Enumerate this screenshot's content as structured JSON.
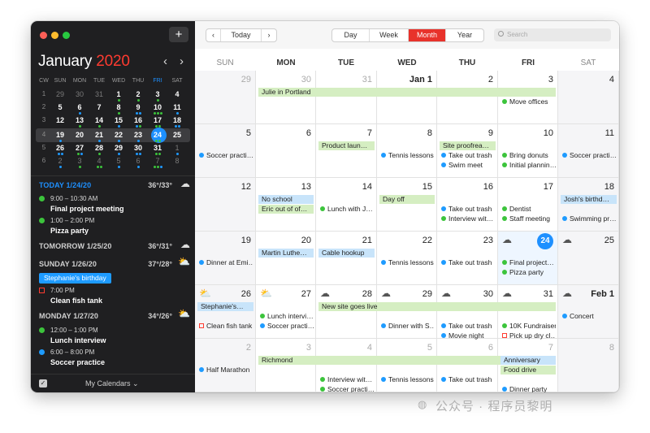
{
  "sidebar": {
    "add_label": "+",
    "month": "January",
    "year": "2020",
    "prev_arrow": "‹",
    "next_arrow": "›",
    "mini_headers": [
      "CW",
      "SUN",
      "MON",
      "TUE",
      "WED",
      "THU",
      "FRI",
      "SAT"
    ],
    "mini_weeks": [
      {
        "cw": "1",
        "days": [
          "29",
          "30",
          "31",
          "1",
          "2",
          "3",
          "4"
        ]
      },
      {
        "cw": "2",
        "days": [
          "5",
          "6",
          "7",
          "8",
          "9",
          "10",
          "11"
        ]
      },
      {
        "cw": "3",
        "days": [
          "12",
          "13",
          "14",
          "15",
          "16",
          "17",
          "18"
        ]
      },
      {
        "cw": "4",
        "days": [
          "19",
          "20",
          "21",
          "22",
          "23",
          "24",
          "25"
        ]
      },
      {
        "cw": "5",
        "days": [
          "26",
          "27",
          "28",
          "29",
          "30",
          "31",
          "1"
        ]
      },
      {
        "cw": "6",
        "days": [
          "2",
          "3",
          "4",
          "5",
          "6",
          "7",
          "8"
        ]
      }
    ],
    "agenda": {
      "today_head": "TODAY 1/24/20",
      "today_temp": "36°/33°",
      "ev1_time": "9:00 – 10:30 AM",
      "ev1_title": "Final project meeting",
      "ev2_time": "1:00 – 2:00 PM",
      "ev2_title": "Pizza party",
      "tomorrow_head": "TOMORROW 1/25/20",
      "tomorrow_temp": "36°/31°",
      "sunday_head": "SUNDAY 1/26/20",
      "sunday_temp": "37°/28°",
      "sunday_allday": "Stephanie's birthday",
      "sunday_ev_time": "7:00 PM",
      "sunday_ev_title": "Clean fish tank",
      "monday_head": "MONDAY 1/27/20",
      "monday_temp": "34°/26°",
      "mon_ev1_time": "12:00 – 1:00 PM",
      "mon_ev1_title": "Lunch interview",
      "mon_ev2_time": "6:00 – 8:00 PM",
      "mon_ev2_title": "Soccer practice"
    },
    "footer_label": "My Calendars"
  },
  "toolbar": {
    "prev": "‹",
    "today": "Today",
    "next": "›",
    "views": [
      "Day",
      "Week",
      "Month",
      "Year"
    ],
    "selected_view": "Month",
    "search_placeholder": "Search"
  },
  "weekdays": [
    "SUN",
    "MON",
    "TUE",
    "WED",
    "THU",
    "FRI",
    "SAT"
  ],
  "weeks": [
    [
      "29",
      "30",
      "31",
      "Jan 1",
      "2",
      "3",
      "4"
    ],
    [
      "5",
      "6",
      "7",
      "8",
      "9",
      "10",
      "11"
    ],
    [
      "12",
      "13",
      "14",
      "15",
      "16",
      "17",
      "18"
    ],
    [
      "19",
      "20",
      "21",
      "22",
      "23",
      "24",
      "25"
    ],
    [
      "26",
      "27",
      "28",
      "29",
      "30",
      "31",
      "Feb 1"
    ],
    [
      "2",
      "3",
      "4",
      "5",
      "6",
      "7",
      "8"
    ]
  ],
  "events": {
    "julie": "Julie in Portland",
    "move_offices": "Move offices",
    "soccer1": "Soccer practi…",
    "product_launch": "Product laun…",
    "tennis1": "Tennis lessons",
    "site_proof": "Site proofrea…",
    "trash1": "Take out trash",
    "swim_meet": "Swim meet",
    "bring_donuts": "Bring donuts",
    "initial_planning": "Initial plannin…",
    "soccer2": "Soccer practi…",
    "no_school": "No school",
    "eric_out": "Eric out of of…",
    "lunch_j": "Lunch with J…",
    "day_off": "Day off",
    "trash2": "Take out trash",
    "interview_w1": "Interview wit…",
    "dentist": "Dentist",
    "staff_meeting": "Staff meeting",
    "josh_bday": "Josh's birthd…",
    "swimming_pr": "Swimming pr…",
    "dinner_emi": "Dinner at Emi…",
    "mlk": "Martin Luthe…",
    "cable": "Cable hookup",
    "tennis2": "Tennis lessons",
    "trash3": "Take out trash",
    "final_project": "Final project…",
    "pizza_party": "Pizza party",
    "steph_bday": "Stephanie's…",
    "clean_fish": "Clean fish tank",
    "lunch_interv": "Lunch intervi…",
    "soccer3": "Soccer practi…",
    "new_site": "New site goes live",
    "dinner_s": "Dinner with S…",
    "trash4": "Take out trash",
    "movie_night": "Movie night",
    "fundraiser": "10K Fundraiser",
    "pick_up_dry": "Pick up dry cl…",
    "concert": "Concert",
    "half_marathon": "Half Marathon",
    "richmond": "Richmond",
    "interview_w2": "Interview wit…",
    "soccer4": "Soccer practi…",
    "tennis3": "Tennis lessons",
    "trash5": "Take out trash",
    "anniversary": "Anniversary",
    "food_drive": "Food drive",
    "dinner_party": "Dinner party"
  },
  "colors": {
    "accent_red": "#e8322b",
    "today_blue": "#1e90ff",
    "event_green": "#3cc43c",
    "event_blue": "#1e9bff",
    "allday_green": "#d5eec2",
    "allday_blue": "#c8e4fa"
  },
  "watermark": "公众号 · 程序员黎明"
}
